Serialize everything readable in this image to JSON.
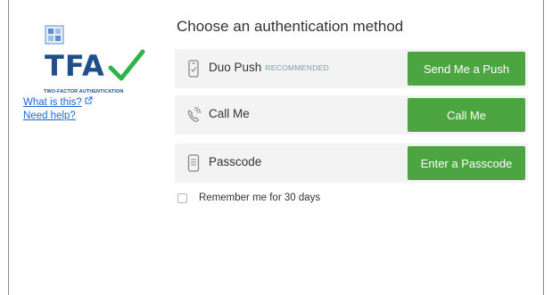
{
  "sidebar": {
    "logo": {
      "wordmark": "TFA",
      "subtitle": "TWO-FACTOR AUTHENTICATION",
      "check_color": "#2fb34a",
      "brand_color": "#1f4e8c"
    },
    "links": {
      "what_is_this": "What is this?",
      "need_help": "Need help?"
    }
  },
  "main": {
    "heading": "Choose an authentication method",
    "methods": [
      {
        "icon": "phone-icon",
        "label": "Duo Push",
        "badge": "RECOMMENDED",
        "button": "Send Me a Push"
      },
      {
        "icon": "phone-call-icon",
        "label": "Call Me",
        "badge": "",
        "button": "Call Me"
      },
      {
        "icon": "passcode-icon",
        "label": "Passcode",
        "badge": "",
        "button": "Enter a Passcode"
      }
    ],
    "remember_label": "Remember me for 30 days",
    "remember_checked": false,
    "button_color": "#4da541"
  }
}
